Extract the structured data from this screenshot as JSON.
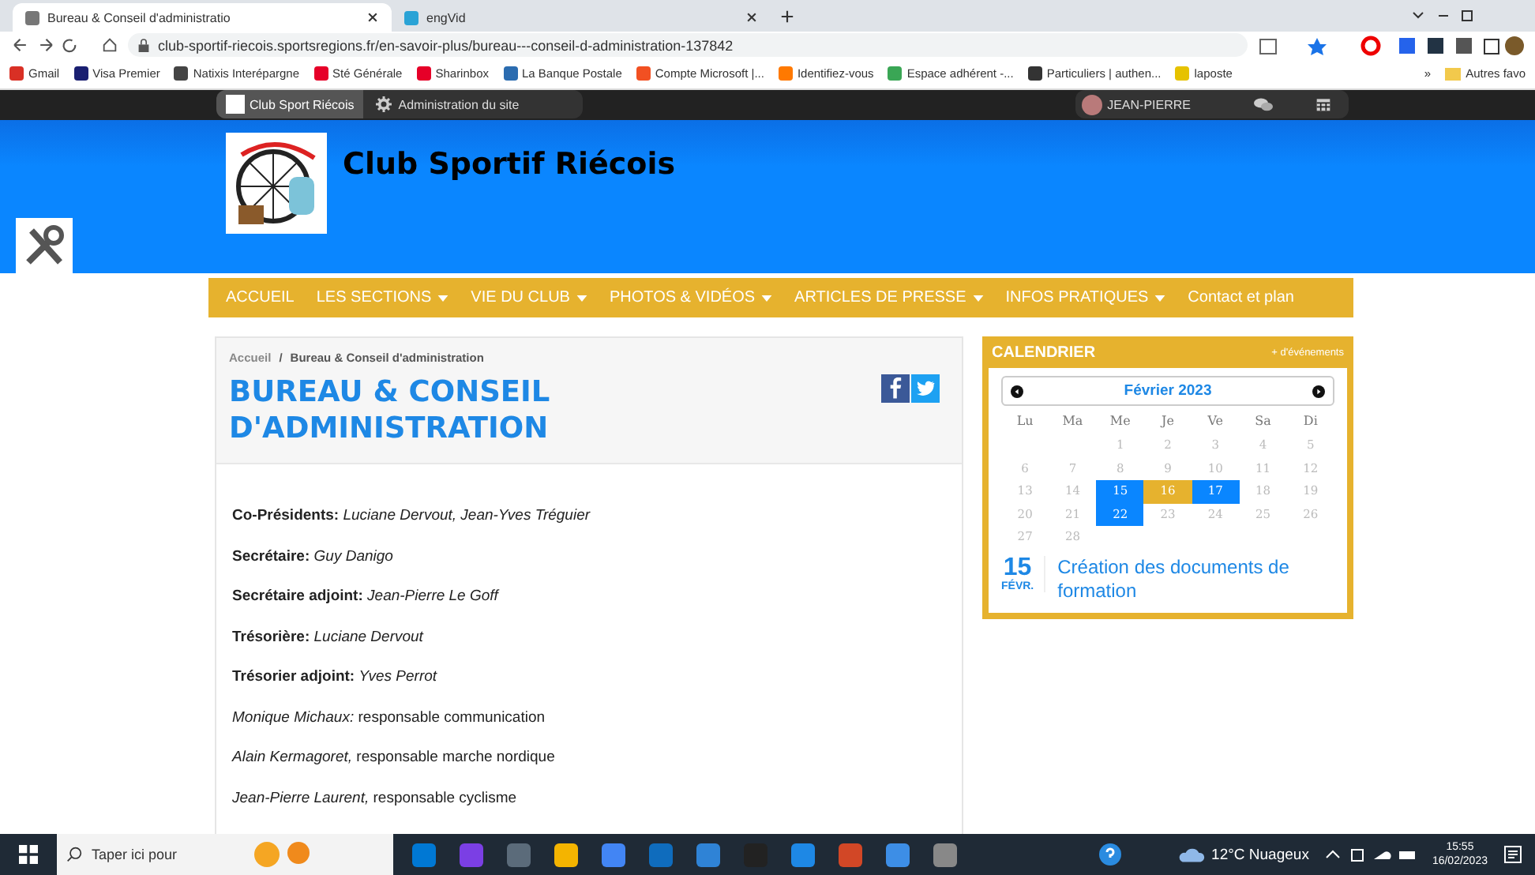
{
  "browser": {
    "tabs": [
      {
        "title": "Bureau & Conseil d'administratio",
        "selected": true
      },
      {
        "title": "engVid",
        "selected": false
      }
    ],
    "url": "club-sportif-riecois.sportsregions.fr/en-savoir-plus/bureau---conseil-d-administration-137842",
    "bookmarks": [
      {
        "label": "Gmail",
        "color": "#d93025"
      },
      {
        "label": "Visa Premier",
        "color": "#1a1f71"
      },
      {
        "label": "Natixis Interépargne",
        "color": "#444444"
      },
      {
        "label": "Sté Générale",
        "color": "#e60028"
      },
      {
        "label": "Sharinbox",
        "color": "#e60028"
      },
      {
        "label": "La Banque Postale",
        "color": "#2b6cb0"
      },
      {
        "label": "Compte Microsoft |...",
        "color": "#f25022"
      },
      {
        "label": "Identifiez-vous",
        "color": "#ff7900"
      },
      {
        "label": "Espace adhérent -...",
        "color": "#3aa655"
      },
      {
        "label": "Particuliers | authen...",
        "color": "#333333"
      },
      {
        "label": "laposte",
        "color": "#e6c200"
      }
    ],
    "more": "»",
    "other_bookmarks": "Autres favo"
  },
  "admin_bar": {
    "site": "Club Sport Riécois",
    "admin": "Administration du site",
    "user": "JEAN-PIERRE"
  },
  "header": {
    "title": "Club Sportif Riécois"
  },
  "nav": [
    {
      "label": "ACCUEIL",
      "dropdown": false
    },
    {
      "label": "LES SECTIONS",
      "dropdown": true
    },
    {
      "label": "VIE DU CLUB",
      "dropdown": true
    },
    {
      "label": "PHOTOS & VIDÉOS",
      "dropdown": true
    },
    {
      "label": "ARTICLES DE PRESSE",
      "dropdown": true
    },
    {
      "label": "INFOS PRATIQUES",
      "dropdown": true
    },
    {
      "label": "Contact et plan",
      "dropdown": false
    }
  ],
  "breadcrumb": {
    "home": "Accueil",
    "separator": "/",
    "current": "Bureau & Conseil d'administration"
  },
  "page_title": "BUREAU & CONSEIL D'ADMINISTRATION",
  "members": [
    "**Co-Présidents:** *Luciane Dervout, Jean-Yves Tréguier*",
    "**Secrétaire:** *Guy Danigo*",
    "**Secrétaire adjoint:** *Jean-Pierre Le Goff*",
    "**Trésorière:** *Luciane Dervout*",
    "**Trésorier adjoint:** *Yves Perrot*",
    "*Monique Michaux:* responsable communication",
    "*Alain Kermagoret,* responsable marche nordique",
    "*Jean-Pierre Laurent,* responsable cyclisme"
  ],
  "calendar": {
    "title": "CALENDRIER",
    "more_link": "+ d'événements",
    "month": "Février 2023",
    "weekdays": [
      "Lu",
      "Ma",
      "Me",
      "Je",
      "Ve",
      "Sa",
      "Di"
    ],
    "weeks": [
      [
        {
          "day": "1",
          "kind": "plain"
        },
        {
          "day": "2",
          "kind": "plain"
        },
        {
          "day": "3",
          "kind": "plain"
        },
        {
          "day": "4",
          "kind": "plain"
        },
        {
          "day": "5",
          "kind": "plain"
        }
      ],
      [
        {
          "day": "6",
          "kind": "plain"
        },
        {
          "day": "7",
          "kind": "plain"
        },
        {
          "day": "8",
          "kind": "plain"
        },
        {
          "day": "9",
          "kind": "plain"
        },
        {
          "day": "10",
          "kind": "plain"
        },
        {
          "day": "11",
          "kind": "plain"
        },
        {
          "day": "12",
          "kind": "plain"
        }
      ],
      [
        {
          "day": "13",
          "kind": "plain"
        },
        {
          "day": "14",
          "kind": "plain"
        },
        {
          "day": "15",
          "kind": "event"
        },
        {
          "day": "16",
          "kind": "today"
        },
        {
          "day": "17",
          "kind": "event"
        },
        {
          "day": "18",
          "kind": "plain"
        },
        {
          "day": "19",
          "kind": "plain"
        }
      ],
      [
        {
          "day": "20",
          "kind": "plain"
        },
        {
          "day": "21",
          "kind": "plain"
        },
        {
          "day": "22",
          "kind": "event"
        },
        {
          "day": "23",
          "kind": "plain"
        },
        {
          "day": "24",
          "kind": "plain"
        },
        {
          "day": "25",
          "kind": "plain"
        },
        {
          "day": "26",
          "kind": "plain"
        }
      ],
      [
        {
          "day": "27",
          "kind": "plain"
        },
        {
          "day": "28",
          "kind": "plain"
        }
      ]
    ],
    "event": {
      "day": "15",
      "month": "FÉVR.",
      "title": "Création des documents de formation"
    }
  },
  "taskbar": {
    "search_placeholder": "Taper ici pour",
    "weather": "12°C Nuageux",
    "time": "15:55",
    "date": "16/02/2023"
  }
}
